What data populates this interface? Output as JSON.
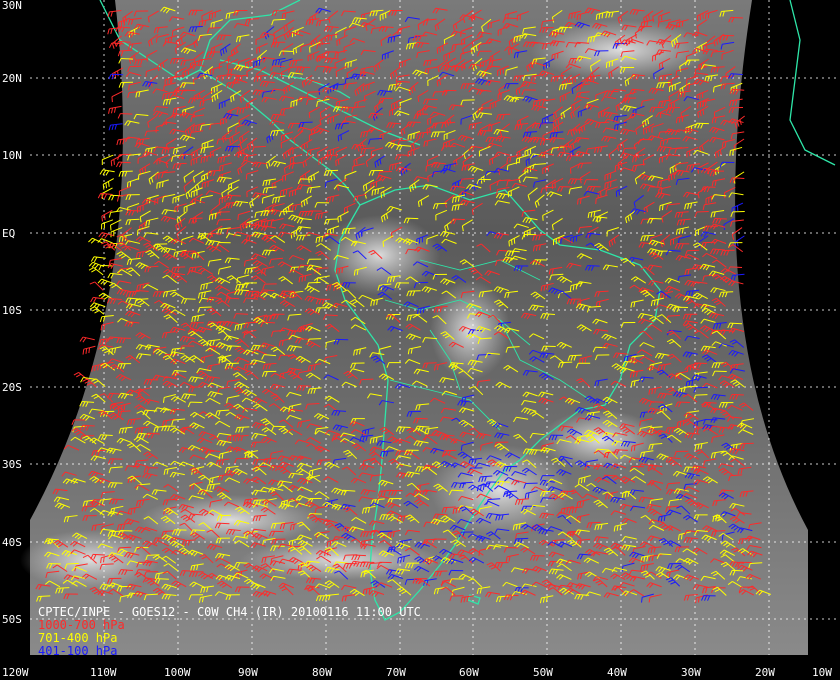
{
  "title": "CPTEC/INPE - GOES12 - C0W CH4 (IR) 20100116 11:00 UTC",
  "legend": [
    {
      "label": "1000-700 hPa",
      "color": "#ff2a2a"
    },
    {
      "label": "701-400 hPa",
      "color": "#ffff00"
    },
    {
      "label": "401-100 hPa",
      "color": "#1a1aff"
    }
  ],
  "lat_labels": [
    "30N",
    "20N",
    "10N",
    "EQ",
    "10S",
    "20S",
    "30S",
    "40S",
    "50S"
  ],
  "lon_labels": [
    "120W",
    "110W",
    "100W",
    "90W",
    "80W",
    "70W",
    "60W",
    "50W",
    "40W",
    "30W",
    "20W",
    "10W"
  ],
  "colors": {
    "background": "#000000",
    "coastline": "#2ee6a8",
    "grid": "#ffffff"
  }
}
